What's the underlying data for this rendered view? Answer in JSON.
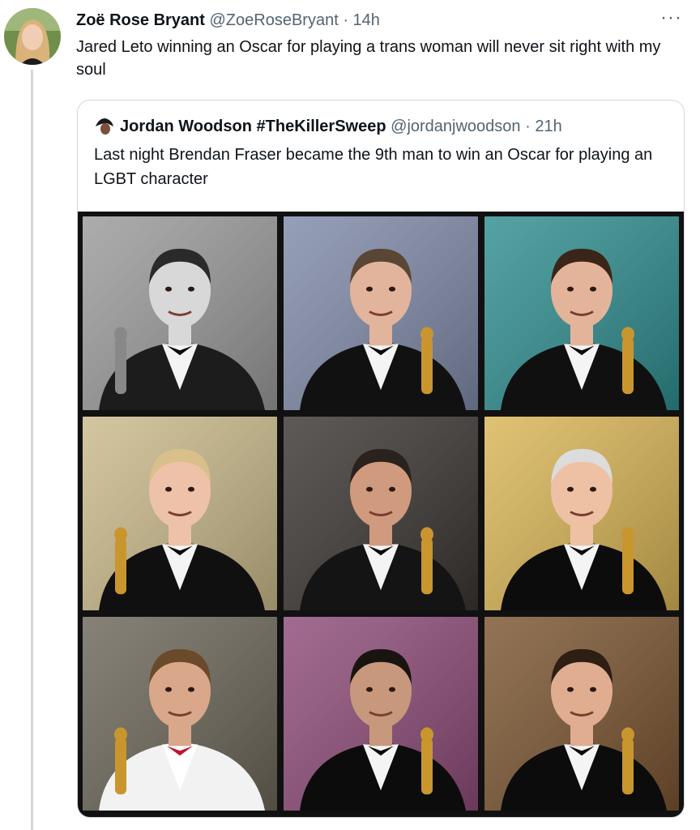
{
  "tweet": {
    "author_name": "Zoë Rose Bryant",
    "author_handle": "@ZoeRoseBryant",
    "separator": " · ",
    "time": "14h",
    "more_label": "···",
    "text": "Jared Leto winning an Oscar for playing a trans woman will never sit right with my soul"
  },
  "quote": {
    "author_name": "Jordan Woodson #TheKillerSweep",
    "author_handle": "@jordanjwoodson",
    "separator": " · ",
    "time": "21h",
    "text": "Last night Brendan Fraser became the 9th man to win an Oscar for playing an LGBT character"
  },
  "photos": [
    {
      "tone": "bw",
      "bg": "#9a9a9a",
      "skin": "#d8d8d8",
      "suit": "#1c1c1c",
      "hair": "#2a2a2a"
    },
    {
      "tone": "color",
      "bg": "#7f8aa8",
      "skin": "#e2b49c",
      "suit": "#111111",
      "hair": "#5a4634"
    },
    {
      "tone": "color",
      "bg": "#2f8d8f",
      "skin": "#e4b49a",
      "suit": "#101010",
      "hair": "#3a2618"
    },
    {
      "tone": "color",
      "bg": "#c9b98a",
      "skin": "#eec2a8",
      "suit": "#101010",
      "hair": "#d9c08a"
    },
    {
      "tone": "color",
      "bg": "#3a3532",
      "skin": "#d09a7e",
      "suit": "#141414",
      "hair": "#2a221c"
    },
    {
      "tone": "color",
      "bg": "#d8b455",
      "skin": "#eec1a5",
      "suit": "#0c0c0c",
      "hair": "#dcdcdc"
    },
    {
      "tone": "color",
      "bg": "#6c6659",
      "skin": "#d9a88a",
      "suit": "#f2f2f2",
      "hair": "#6a4a2a"
    },
    {
      "tone": "color",
      "bg": "#8c4b78",
      "skin": "#c8987c",
      "suit": "#0c0c0c",
      "hair": "#1a1410"
    },
    {
      "tone": "color",
      "bg": "#7a5430",
      "skin": "#e0ad90",
      "suit": "#0c0c0c",
      "hair": "#2e1e14"
    }
  ]
}
